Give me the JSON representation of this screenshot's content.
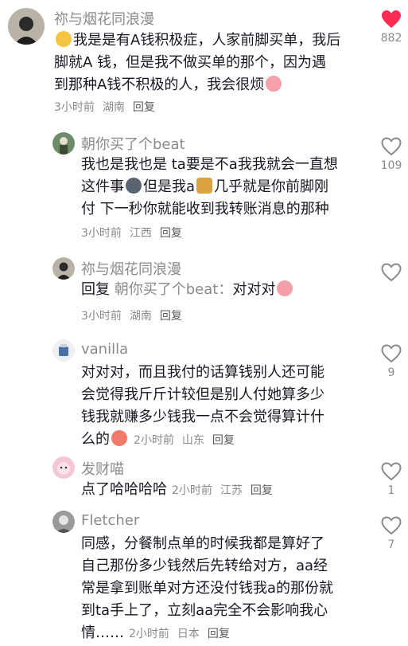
{
  "comments": [
    {
      "username": "祢与烟花同浪漫",
      "lines": [
        "我是是有A钱积极症，人家前脚买单，我后",
        "脚就A 钱，但是我不做买单的那个，因为遇",
        "到那种A钱不积极的人，我会很烦"
      ],
      "time": "3小时前",
      "location": "湖南",
      "reply_label": "回复",
      "likes": "882",
      "liked": true
    },
    {
      "username": "朝你买了个beat",
      "lines": [
        "我也是我也是 ta要是不a我我就会一直想",
        "这件事",
        "但是我a",
        "几乎就是你前脚刚",
        "付 下一秒你就能收到我转账消息的那种"
      ],
      "time": "3小时前",
      "location": "江西",
      "reply_label": "回复",
      "likes": "109",
      "liked": false
    },
    {
      "username": "祢与烟花同浪漫",
      "reply_prefix": "回复",
      "reply_target": "朝你买了个beat：",
      "text": "对对对",
      "time": "3小时前",
      "location": "湖南",
      "reply_label": "回复",
      "likes": "",
      "liked": false
    },
    {
      "username": "vanilla",
      "lines": [
        "对对对，而且我付的话算钱别人还可能",
        "会觉得我斤斤计较但是别人付她算多少",
        "钱我就赚多少钱我一点不会觉得算计什",
        "么的"
      ],
      "time": "2小时前",
      "location": "山东",
      "reply_label": "回复",
      "likes": "9",
      "liked": false
    },
    {
      "username": "发财喵",
      "lines": [
        "点了哈哈哈哈"
      ],
      "time": "2小时前",
      "location": "江苏",
      "reply_label": "回复",
      "likes": "1",
      "liked": false
    },
    {
      "username": "Fletcher",
      "lines": [
        "同感，分餐制点单的时候我都是算好了",
        "自己那份多少钱然后先转给对方，aa经",
        "常是拿到账单对方还没付钱我a的那份就",
        "到ta手上了，立刻aa完全不会影响我心",
        "情……"
      ],
      "time": "2小时前",
      "location": "日本",
      "reply_label": "回复",
      "likes": "7",
      "liked": false
    }
  ],
  "icons": {
    "like": "heart-outline-icon",
    "liked": "heart-filled-icon",
    "emoji": [
      "grinning-face-emoji",
      "cat-emoji",
      "money-bag-emoji",
      "crying-face-emoji",
      "blushing-face-emoji"
    ]
  },
  "colors": {
    "liked_heart": "#fe2c55",
    "text": "#161823",
    "muted": "#8a8a8a"
  }
}
